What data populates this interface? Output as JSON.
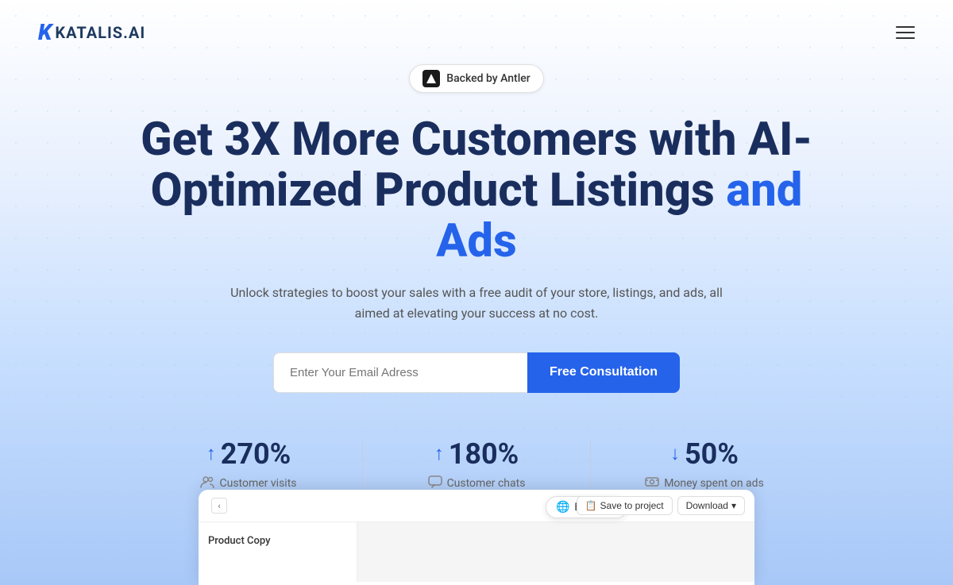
{
  "brand": {
    "logo_icon": "K",
    "logo_name": "KATALIS.AI"
  },
  "nav": {
    "hamburger_label": "Menu"
  },
  "badge": {
    "icon_text": "A",
    "text": "Backed by Antler"
  },
  "hero": {
    "heading_part1": "Get 3X More Customers with AI-Optimized Product Listings",
    "heading_highlight": "and Ads",
    "subheading": "Unlock strategies to boost your sales with a free audit of your store, listings, and ads, all aimed at elevating your success at no cost."
  },
  "form": {
    "email_placeholder": "Enter Your Email Adress",
    "cta_label": "Free Consultation"
  },
  "stats": [
    {
      "arrow": "up",
      "value": "270%",
      "icon": "👥",
      "label": "Customer visits"
    },
    {
      "arrow": "up",
      "value": "180%",
      "icon": "💬",
      "label": "Customer chats"
    },
    {
      "arrow": "down",
      "value": "50%",
      "icon": "💰",
      "label": "Money spent on ads"
    }
  ],
  "ui_preview": {
    "nav_arrow": "‹",
    "language": "English",
    "save_label": "Save to project",
    "download_label": "Download",
    "product_copy": "Product Copy"
  }
}
